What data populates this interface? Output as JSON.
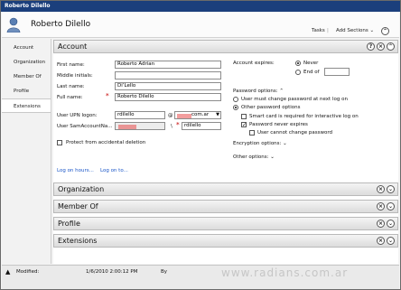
{
  "window": {
    "title": "Roberto Dilello"
  },
  "header": {
    "user_name": "Roberto Dilello",
    "tasks_label": "Tasks",
    "add_sections_label": "Add Sections"
  },
  "sidebar": {
    "items": [
      {
        "label": "Account"
      },
      {
        "label": "Organization"
      },
      {
        "label": "Member Of"
      },
      {
        "label": "Profile"
      },
      {
        "label": "Extensions"
      }
    ]
  },
  "account": {
    "title": "Account",
    "first_name_label": "First name:",
    "first_name_value": "Roberto Adrian",
    "middle_label": "Middle initials:",
    "middle_value": "",
    "last_label": "Last name:",
    "last_value": "Di’Lello",
    "full_label": "Full name:",
    "full_value": "Roberto Dilello",
    "upn_label": "User UPN logon:",
    "upn_value": "rdilello",
    "at_sign": "@",
    "upn_domain": "com.ar",
    "sam_label": "User SamAccountNa...",
    "sam_sep": "\\",
    "sam_value": "rdilello",
    "protect_label": "Protect from accidental deletion",
    "logon_hours_link": "Log on hours...",
    "log_on_to_link": "Log on to...",
    "expires_label": "Account expires:",
    "never_label": "Never",
    "end_of_label": "End of",
    "pw_options_label": "Password options:",
    "pw_opt1": "User must change password at next log on",
    "pw_opt2": "Other password options",
    "smart_card_label": "Smart card is required for interactive log on",
    "never_expires_label": "Password never expires",
    "cannot_change_label": "User cannot change password",
    "enc_label": "Encryption options:",
    "other_label": "Other options:"
  },
  "sections": {
    "organization": "Organization",
    "member_of": "Member Of",
    "profile": "Profile",
    "extensions": "Extensions"
  },
  "status": {
    "modified_label": "Modified:",
    "modified_value": "1/6/2010 2:00:12 PM",
    "by_label": "By"
  },
  "watermark": "www.radians.com.ar"
}
